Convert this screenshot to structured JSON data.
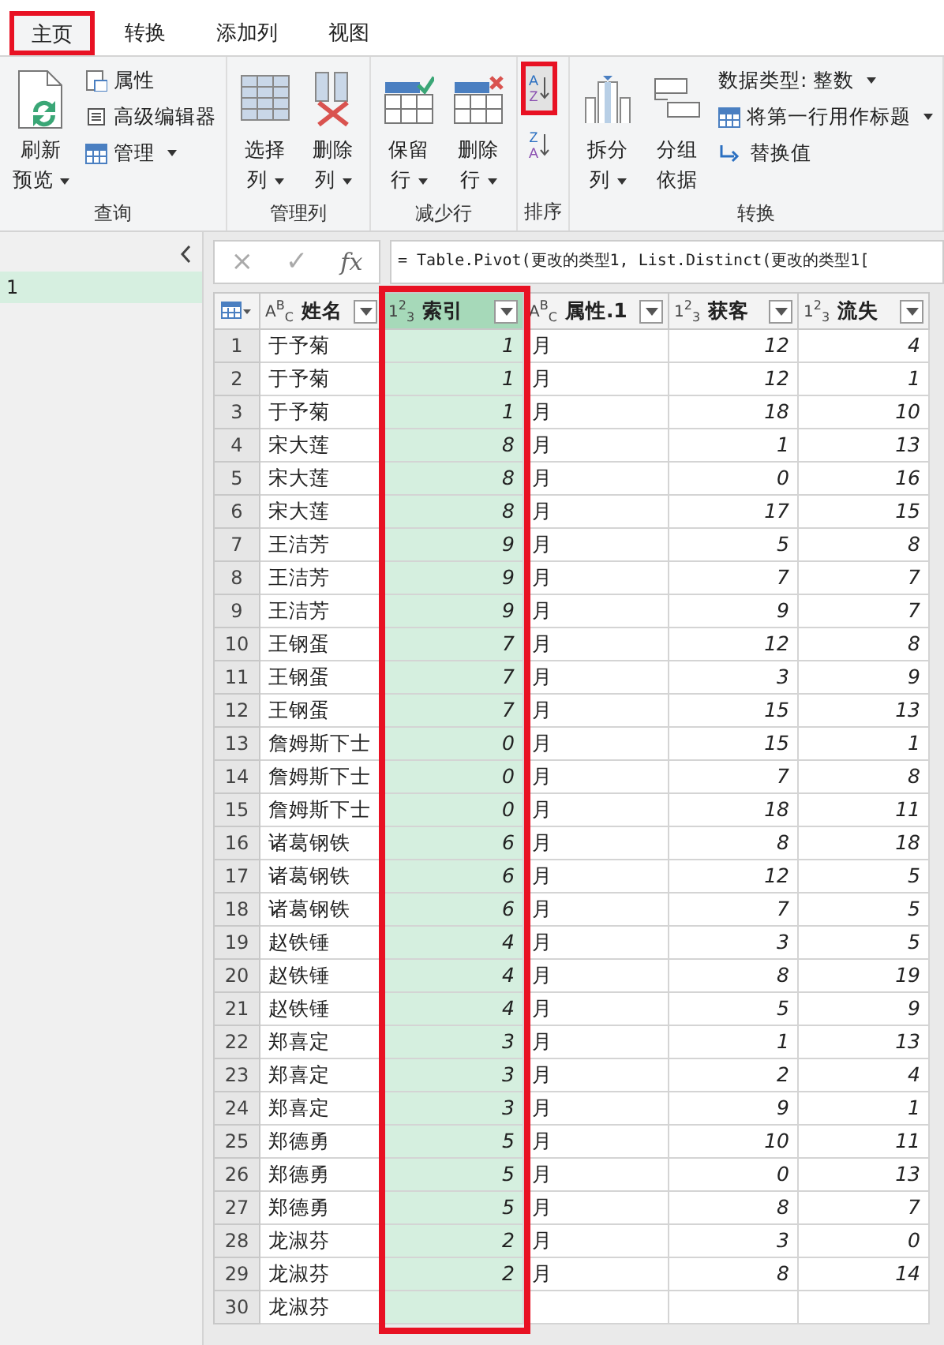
{
  "tabs": [
    {
      "label": "主页",
      "selected": true,
      "highlighted": true
    },
    {
      "label": "转换",
      "selected": false,
      "highlighted": false
    },
    {
      "label": "添加列",
      "selected": false,
      "highlighted": false
    },
    {
      "label": "视图",
      "selected": false,
      "highlighted": false
    }
  ],
  "ribbon": {
    "groups": [
      {
        "label": "查询",
        "items": [
          {
            "kind": "large",
            "lines": [
              "刷新",
              "预览"
            ],
            "dropdown": true
          },
          {
            "kind": "stack",
            "items": [
              {
                "label": "属性",
                "dropdown": false
              },
              {
                "label": "高级编辑器",
                "dropdown": false
              },
              {
                "label": "管理",
                "dropdown": true
              }
            ]
          }
        ]
      },
      {
        "label": "管理列",
        "items": [
          {
            "kind": "large",
            "lines": [
              "选择",
              "列"
            ],
            "dropdown": true
          },
          {
            "kind": "large",
            "lines": [
              "删除",
              "列"
            ],
            "dropdown": true
          }
        ]
      },
      {
        "label": "减少行",
        "items": [
          {
            "kind": "large",
            "lines": [
              "保留",
              "行"
            ],
            "dropdown": true
          },
          {
            "kind": "large",
            "lines": [
              "删除",
              "行"
            ],
            "dropdown": true
          }
        ]
      },
      {
        "label": "排序",
        "items": [
          {
            "kind": "sort",
            "buttons": [
              {
                "top": "A",
                "bottom": "Z",
                "highlighted": true
              },
              {
                "top": "Z",
                "bottom": "A",
                "highlighted": false
              }
            ]
          }
        ]
      },
      {
        "label": "转换",
        "items": [
          {
            "kind": "large",
            "lines": [
              "拆分",
              "列"
            ],
            "dropdown": true
          },
          {
            "kind": "large",
            "lines": [
              "分组",
              "依据"
            ],
            "dropdown": false
          },
          {
            "kind": "stack",
            "items": [
              {
                "label": "数据类型: 整数",
                "dropdown": true
              },
              {
                "label": "将第一行用作标题",
                "dropdown": true
              },
              {
                "label": "替换值",
                "dropdown": false
              }
            ]
          }
        ]
      }
    ]
  },
  "queries": {
    "items": [
      {
        "label": "1",
        "selected": true
      }
    ]
  },
  "formula_bar": {
    "cancel": "×",
    "confirm": "✓",
    "fx": "fx",
    "formula": "= Table.Pivot(更改的类型1, List.Distinct(更改的类型1["
  },
  "table": {
    "columns": [
      {
        "kind": "text",
        "type": "A$^{B}$$_{C}$",
        "label": "姓名",
        "selected": false,
        "highlighted": false
      },
      {
        "kind": "number",
        "type": "1$^{2}$$_{3}$",
        "label": "索引",
        "selected": true,
        "highlighted": true
      },
      {
        "kind": "text",
        "type": "A$^{B}$$_{C}$",
        "label": "属性.1",
        "selected": false,
        "highlighted": false
      },
      {
        "kind": "number",
        "type": "1$^{2}$$_{3}$",
        "label": "获客",
        "selected": false,
        "highlighted": false
      },
      {
        "kind": "number",
        "type": "1$^{2}$$_{3}$",
        "label": "流失",
        "selected": false,
        "highlighted": false
      }
    ],
    "rows": [
      {
        "num": "1",
        "cells": [
          "于予菊",
          "1",
          "月",
          "12",
          "4"
        ]
      },
      {
        "num": "2",
        "cells": [
          "于予菊",
          "1",
          "月",
          "12",
          "1"
        ]
      },
      {
        "num": "3",
        "cells": [
          "于予菊",
          "1",
          "月",
          "18",
          "10"
        ]
      },
      {
        "num": "4",
        "cells": [
          "宋大莲",
          "8",
          "月",
          "1",
          "13"
        ]
      },
      {
        "num": "5",
        "cells": [
          "宋大莲",
          "8",
          "月",
          "0",
          "16"
        ]
      },
      {
        "num": "6",
        "cells": [
          "宋大莲",
          "8",
          "月",
          "17",
          "15"
        ]
      },
      {
        "num": "7",
        "cells": [
          "王洁芳",
          "9",
          "月",
          "5",
          "8"
        ]
      },
      {
        "num": "8",
        "cells": [
          "王洁芳",
          "9",
          "月",
          "7",
          "7"
        ]
      },
      {
        "num": "9",
        "cells": [
          "王洁芳",
          "9",
          "月",
          "9",
          "7"
        ]
      },
      {
        "num": "10",
        "cells": [
          "王钢蛋",
          "7",
          "月",
          "12",
          "8"
        ]
      },
      {
        "num": "11",
        "cells": [
          "王钢蛋",
          "7",
          "月",
          "3",
          "9"
        ]
      },
      {
        "num": "12",
        "cells": [
          "王钢蛋",
          "7",
          "月",
          "15",
          "13"
        ]
      },
      {
        "num": "13",
        "cells": [
          "詹姆斯下士",
          "0",
          "月",
          "15",
          "1"
        ]
      },
      {
        "num": "14",
        "cells": [
          "詹姆斯下士",
          "0",
          "月",
          "7",
          "8"
        ]
      },
      {
        "num": "15",
        "cells": [
          "詹姆斯下士",
          "0",
          "月",
          "18",
          "11"
        ]
      },
      {
        "num": "16",
        "cells": [
          "诸葛钢铁",
          "6",
          "月",
          "8",
          "18"
        ]
      },
      {
        "num": "17",
        "cells": [
          "诸葛钢铁",
          "6",
          "月",
          "12",
          "5"
        ]
      },
      {
        "num": "18",
        "cells": [
          "诸葛钢铁",
          "6",
          "月",
          "7",
          "5"
        ]
      },
      {
        "num": "19",
        "cells": [
          "赵铁锤",
          "4",
          "月",
          "3",
          "5"
        ]
      },
      {
        "num": "20",
        "cells": [
          "赵铁锤",
          "4",
          "月",
          "8",
          "19"
        ]
      },
      {
        "num": "21",
        "cells": [
          "赵铁锤",
          "4",
          "月",
          "5",
          "9"
        ]
      },
      {
        "num": "22",
        "cells": [
          "郑喜定",
          "3",
          "月",
          "1",
          "13"
        ]
      },
      {
        "num": "23",
        "cells": [
          "郑喜定",
          "3",
          "月",
          "2",
          "4"
        ]
      },
      {
        "num": "24",
        "cells": [
          "郑喜定",
          "3",
          "月",
          "9",
          "1"
        ]
      },
      {
        "num": "25",
        "cells": [
          "郑德勇",
          "5",
          "月",
          "10",
          "11"
        ]
      },
      {
        "num": "26",
        "cells": [
          "郑德勇",
          "5",
          "月",
          "0",
          "13"
        ]
      },
      {
        "num": "27",
        "cells": [
          "郑德勇",
          "5",
          "月",
          "8",
          "7"
        ]
      },
      {
        "num": "28",
        "cells": [
          "龙淑芬",
          "2",
          "月",
          "3",
          "0"
        ]
      },
      {
        "num": "29",
        "cells": [
          "龙淑芬",
          "2",
          "月",
          "8",
          "14"
        ]
      },
      {
        "num": "30",
        "cells": [
          "龙淑芬"
        ]
      }
    ]
  }
}
